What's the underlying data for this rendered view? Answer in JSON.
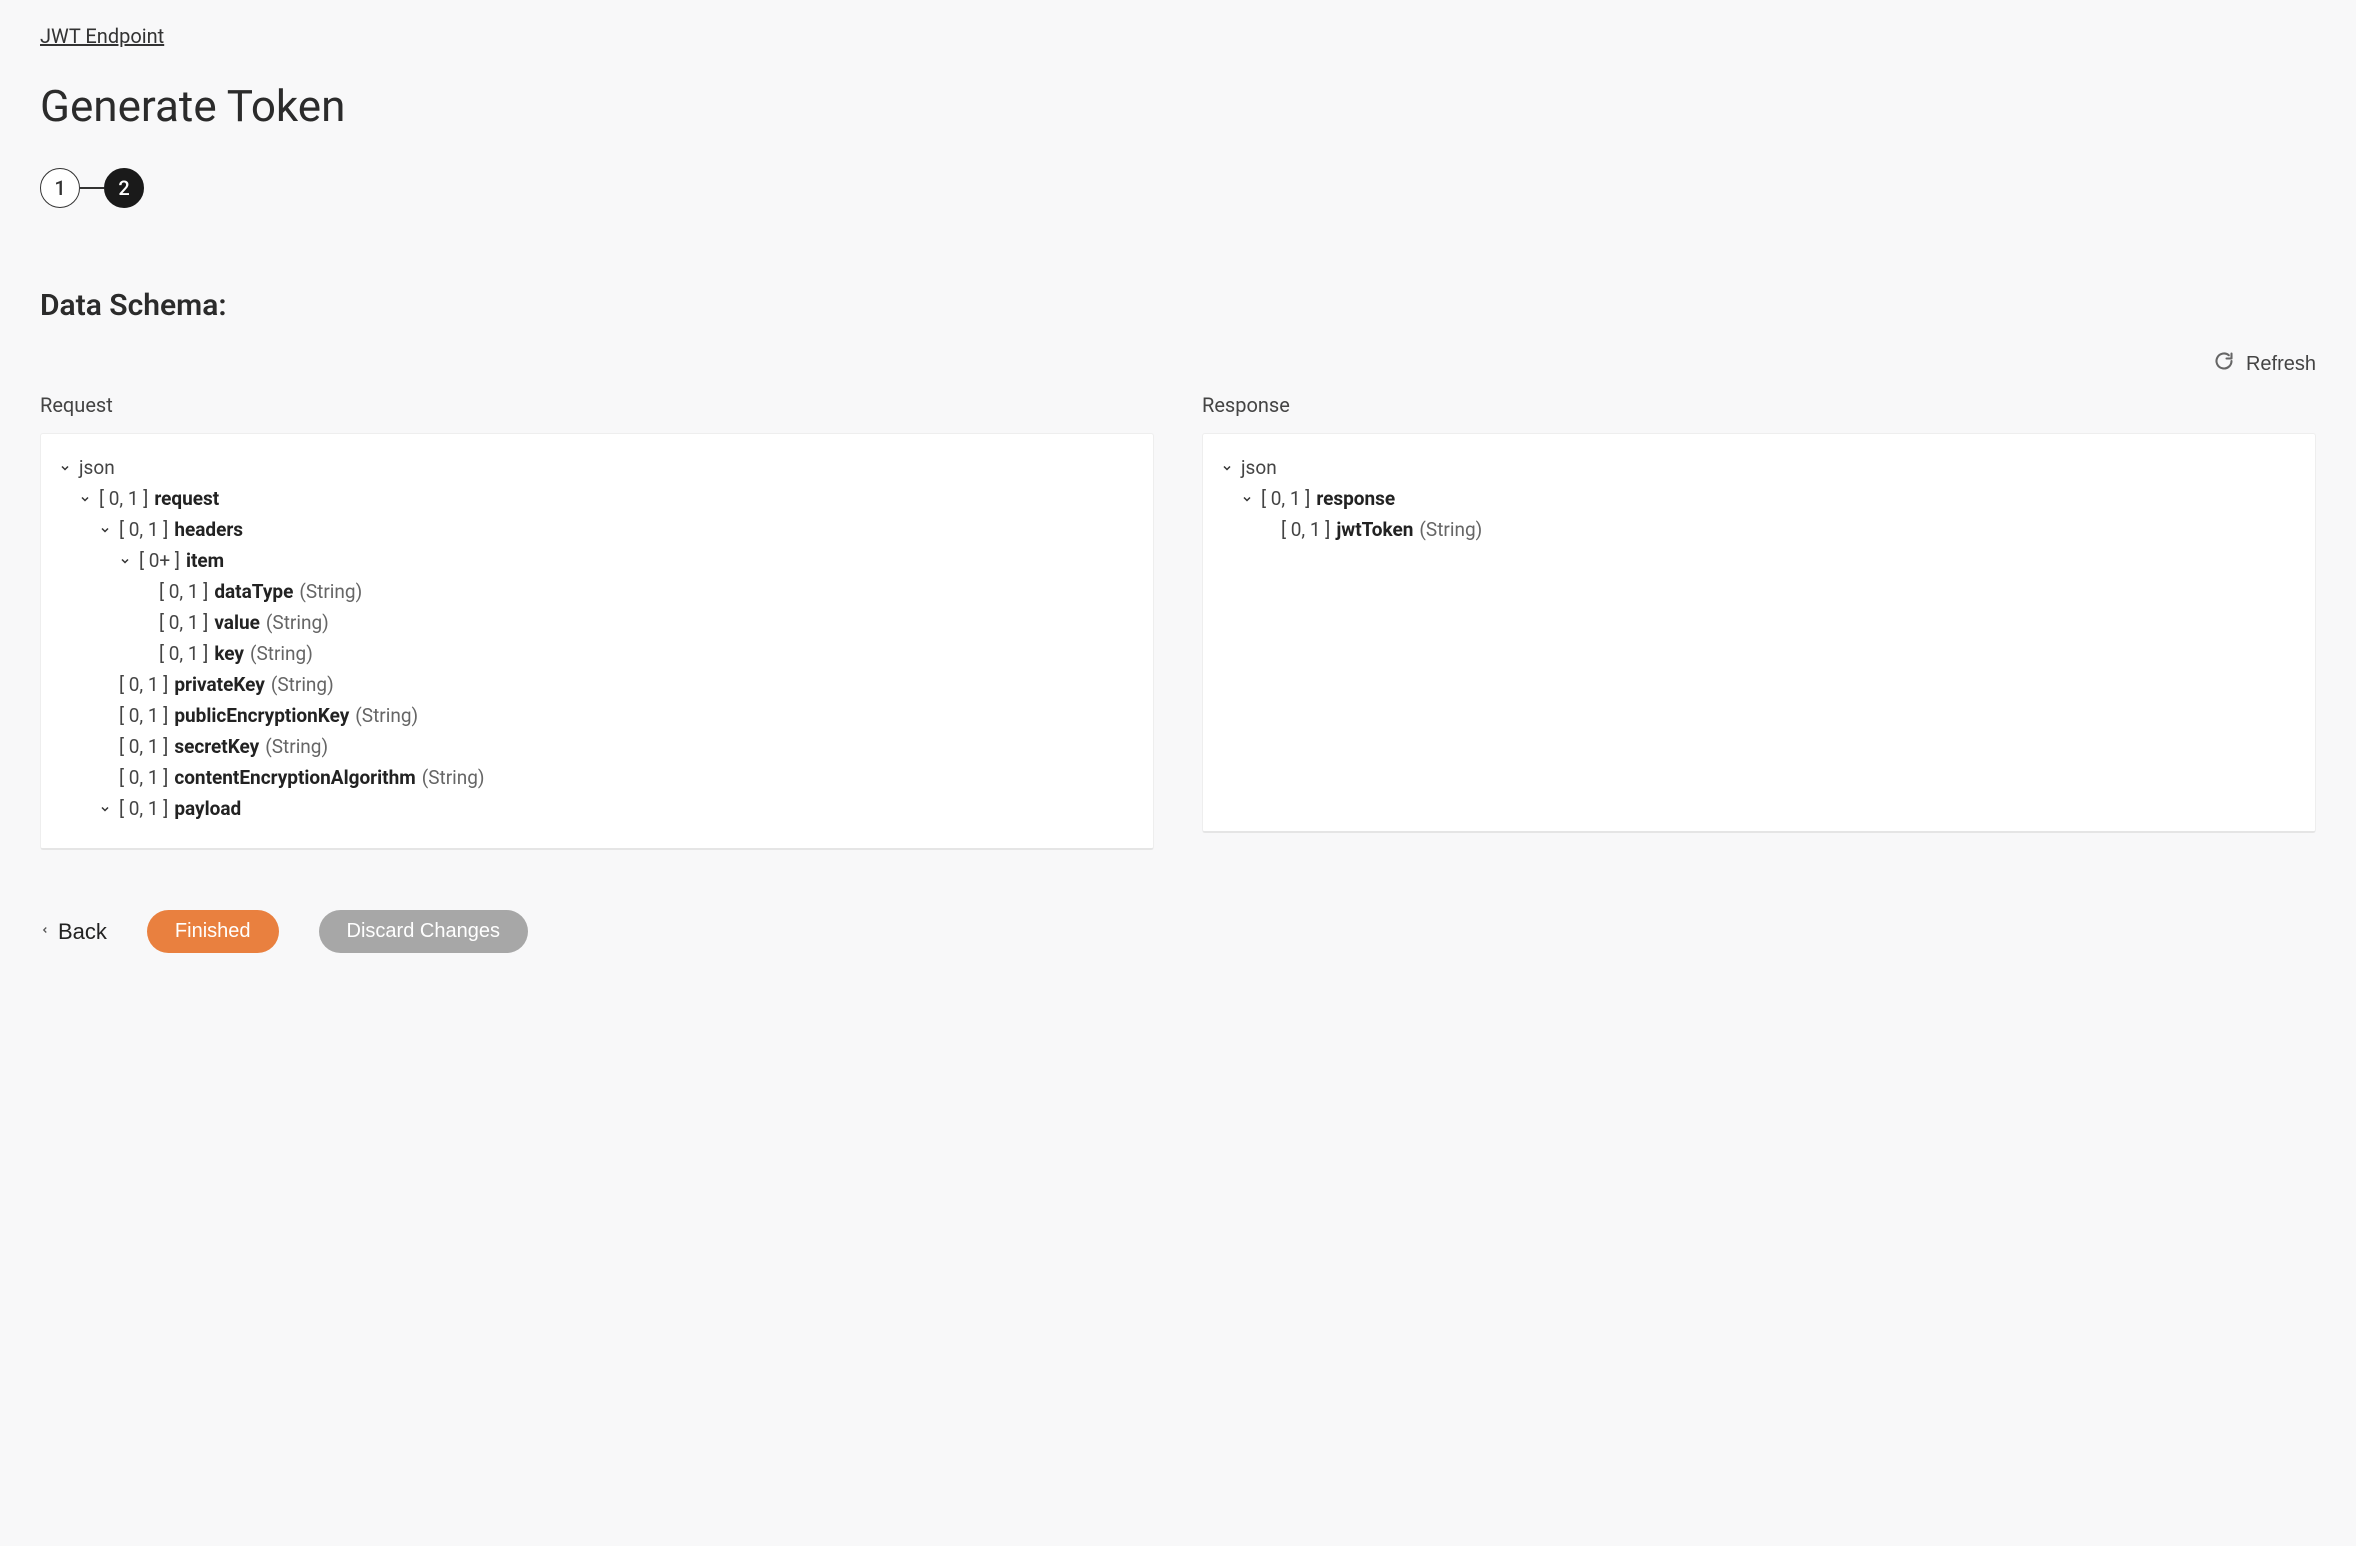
{
  "breadcrumb": "JWT Endpoint",
  "page_title": "Generate Token",
  "stepper": {
    "step1": "1",
    "step2": "2"
  },
  "section_title": "Data Schema:",
  "refresh_label": "Refresh",
  "columns": {
    "request_label": "Request",
    "response_label": "Response"
  },
  "cardinality": {
    "zero_one": "[ 0, 1 ]",
    "zero_plus": "[ 0+ ]"
  },
  "types": {
    "string": "(String)"
  },
  "request_tree": {
    "root": "json",
    "request": "request",
    "headers": "headers",
    "item": "item",
    "dataType": "dataType",
    "value": "value",
    "key": "key",
    "privateKey": "privateKey",
    "publicEncryptionKey": "publicEncryptionKey",
    "secretKey": "secretKey",
    "contentEncryptionAlgorithm": "contentEncryptionAlgorithm",
    "payload": "payload"
  },
  "response_tree": {
    "root": "json",
    "response": "response",
    "jwtToken": "jwtToken"
  },
  "footer": {
    "back": "Back",
    "finished": "Finished",
    "discard": "Discard Changes"
  }
}
